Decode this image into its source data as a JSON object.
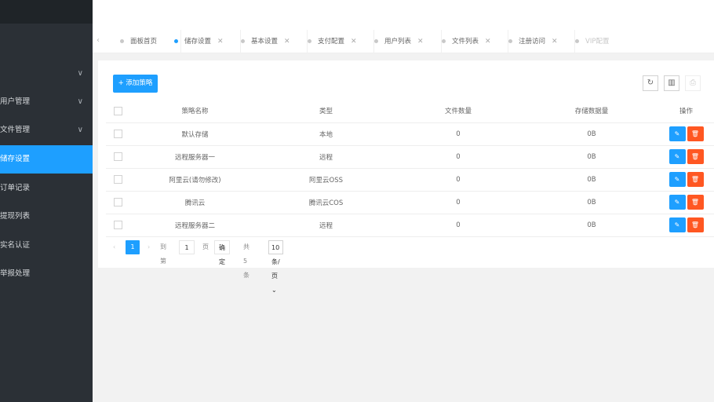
{
  "sidebar": {
    "items": [
      {
        "label": "用户管理",
        "chevron": "∨"
      },
      {
        "label": "文件管理",
        "chevron": "∨"
      },
      {
        "label": "储存设置",
        "active": true
      },
      {
        "label": "订单记录"
      },
      {
        "label": "提现列表"
      },
      {
        "label": "实名认证"
      },
      {
        "label": "举报处理"
      }
    ],
    "first_chevron": "∨"
  },
  "tabs": {
    "prev": "‹",
    "items": [
      {
        "label": "面板首页",
        "close": ""
      },
      {
        "label": "储存设置",
        "close": "✕"
      },
      {
        "label": "基本设置",
        "close": "✕"
      },
      {
        "label": "支付配置",
        "close": "✕"
      },
      {
        "label": "用户列表",
        "close": "✕"
      },
      {
        "label": "文件列表",
        "close": "✕"
      },
      {
        "label": "注册访问",
        "close": "✕"
      },
      {
        "label": "VIP配置",
        "close": ""
      }
    ]
  },
  "toolbar": {
    "add_label": "+ 添加策略",
    "refresh_icon": "↻",
    "columns_icon": "▥",
    "export_icon": "⎙"
  },
  "table": {
    "headers": [
      "策略名称",
      "类型",
      "文件数量",
      "存储数据量",
      "操作"
    ],
    "rows": [
      [
        "默认存储",
        "本地",
        "0",
        "0B"
      ],
      [
        "远程服务器一",
        "远程",
        "0",
        "0B"
      ],
      [
        "阿里云(请勿修改)",
        "阿里云OSS",
        "0",
        "0B"
      ],
      [
        "腾讯云",
        "腾讯云COS",
        "0",
        "0B"
      ],
      [
        "远程服务器二",
        "远程",
        "0",
        "0B"
      ]
    ],
    "edit_icon": "✎",
    "delete_icon": "🗑"
  },
  "pager": {
    "prev": "‹",
    "current": "1",
    "next": "›",
    "goto_label": "到第",
    "page_value": "1",
    "page_unit": "页",
    "confirm": "确定",
    "total": "共 5 条",
    "page_size": "10 条/页"
  },
  "colors": {
    "accent": "#1e9fff",
    "danger": "#ff5722",
    "sidebar_bg": "#2b3036"
  }
}
